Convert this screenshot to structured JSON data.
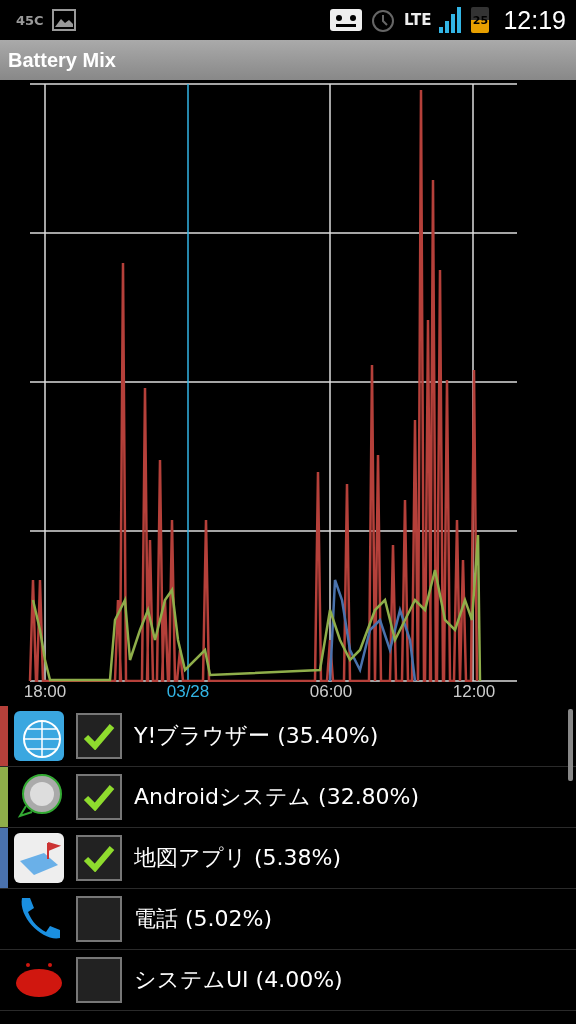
{
  "status_bar": {
    "temperature": "45C",
    "network": "LTE",
    "battery": "25",
    "time": "12:19"
  },
  "title": "Battery Mix",
  "axis_labels": [
    {
      "text": "18:00",
      "highlighted": false
    },
    {
      "text": "03/28",
      "highlighted": true
    },
    {
      "text": "06:00",
      "highlighted": false
    },
    {
      "text": "12:00",
      "highlighted": false
    }
  ],
  "apps": [
    {
      "label": "Y!ブラウザー (35.40%)",
      "checked": true,
      "color": "#b5403a"
    },
    {
      "label": "Androidシステム (32.80%)",
      "checked": true,
      "color": "#8fae4a"
    },
    {
      "label": "地図アプリ (5.38%)",
      "checked": true,
      "color": "#4a72ad"
    },
    {
      "label": "電話 (5.02%)",
      "checked": false
    },
    {
      "label": "システムUI (4.00%)",
      "checked": false
    }
  ]
}
